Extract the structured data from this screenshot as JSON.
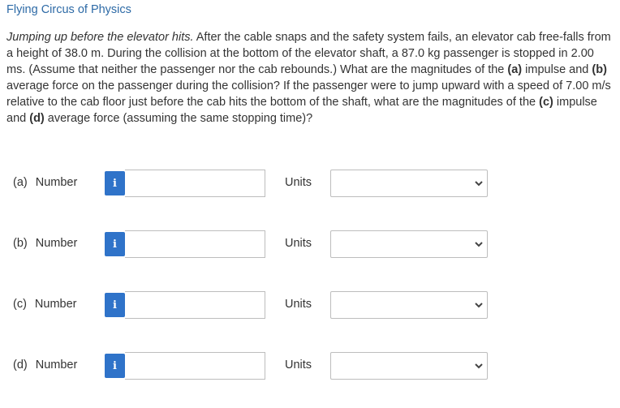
{
  "header": {
    "source": "Flying Circus of Physics"
  },
  "problem": {
    "title": "Jumping up before the elevator hits.",
    "p1": " After the cable snaps and the safety system fails, an elevator cab free-falls from a height of 38.0 m. During the collision at the bottom of the elevator shaft, a 87.0 kg passenger is stopped in 2.00 ms. (Assume that neither the passenger nor the cab rebounds.) What are the magnitudes of the ",
    "a": "(a)",
    "p2": " impulse and ",
    "b": "(b)",
    "p3": " average force on the passenger during the collision? If the passenger were to jump upward with a speed of 7.00 m/s relative to the cab floor just before the cab hits the bottom of the shaft, what are the magnitudes of the ",
    "c": "(c)",
    "p4": " impulse and ",
    "d": "(d)",
    "p5": " average force (assuming the same stopping time)?"
  },
  "answers": [
    {
      "part": "(a)",
      "number_label": "Number",
      "info": "i",
      "value": "",
      "units_label": "Units",
      "units_value": ""
    },
    {
      "part": "(b)",
      "number_label": "Number",
      "info": "i",
      "value": "",
      "units_label": "Units",
      "units_value": ""
    },
    {
      "part": "(c)",
      "number_label": "Number",
      "info": "i",
      "value": "",
      "units_label": "Units",
      "units_value": ""
    },
    {
      "part": "(d)",
      "number_label": "Number",
      "info": "i",
      "value": "",
      "units_label": "Units",
      "units_value": ""
    }
  ],
  "icons": {
    "info": "info-icon",
    "dropdown": "chevron-down-icon"
  },
  "colors": {
    "link": "#2d6aa6",
    "info_button": "#2f73c9",
    "border": "#bdbdbd",
    "text": "#333333"
  }
}
